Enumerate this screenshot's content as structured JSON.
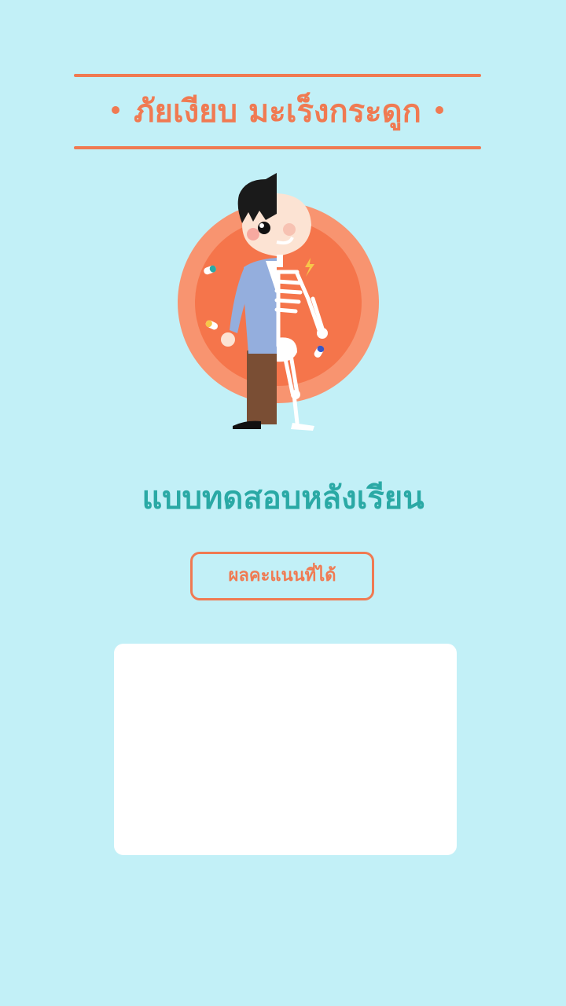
{
  "header": {
    "title": "ภัยเงียบ มะเร็งกระดูก"
  },
  "illustration": {
    "icon": "skeleton-human-icon"
  },
  "page": {
    "title": "แบบทดสอบหลังเรียน"
  },
  "score": {
    "button_label": "ผลคะแนนที่ได้"
  },
  "colors": {
    "background": "#C2F0F7",
    "accent": "#F07A52",
    "title": "#2AA9A5",
    "panel": "#FFFFFF"
  }
}
